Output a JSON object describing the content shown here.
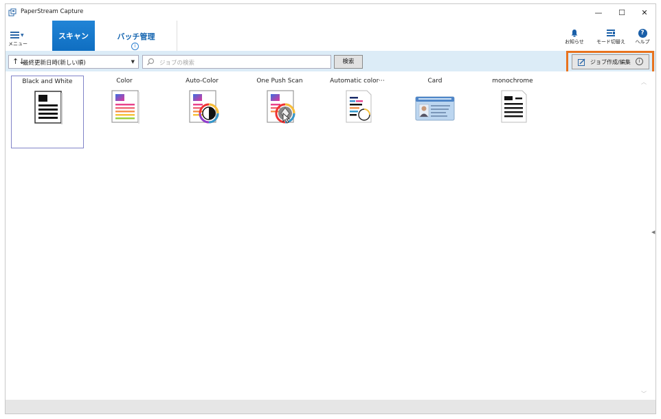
{
  "window": {
    "title": "PaperStream Capture",
    "controls": {
      "minimize": "—",
      "maximize": "☐",
      "close": "✕"
    }
  },
  "ribbon": {
    "menu_label": "メニュー",
    "tabs": [
      {
        "label": "スキャン",
        "active": true
      },
      {
        "label": "バッチ管理",
        "active": false,
        "info_glyph": "i"
      }
    ],
    "tools": [
      {
        "label": "お知らせ",
        "icon": "bell-icon"
      },
      {
        "label": "モード切替え",
        "icon": "mode-switch-icon"
      },
      {
        "label": "ヘルプ",
        "icon": "help-icon",
        "glyph": "?"
      }
    ]
  },
  "toolbar": {
    "sort_value": "最終更新日時(新しい順)",
    "sort_icon_glyph": "↑↓",
    "search_placeholder": "ジョブの検索",
    "search_button": "検索",
    "job_edit_button": "ジョブ作成/編集",
    "job_edit_info": "i"
  },
  "jobs": [
    {
      "label": "Black and White",
      "icon": "black-and-white-doc-icon",
      "selected": true
    },
    {
      "label": "Color",
      "icon": "color-doc-icon",
      "selected": false
    },
    {
      "label": "Auto-Color",
      "icon": "auto-color-doc-icon",
      "selected": false
    },
    {
      "label": "One Push Scan",
      "icon": "one-push-scan-icon",
      "selected": false
    },
    {
      "label": "Automatic color···",
      "icon": "automatic-color-doc-icon",
      "selected": false
    },
    {
      "label": "Card",
      "icon": "id-card-icon",
      "selected": false
    },
    {
      "label": "monochrome",
      "icon": "monochrome-doc-icon",
      "selected": false
    }
  ],
  "colors": {
    "accent": "#1976d2",
    "toolbar_bg": "#dcecf7",
    "highlight": "#e8731e"
  }
}
